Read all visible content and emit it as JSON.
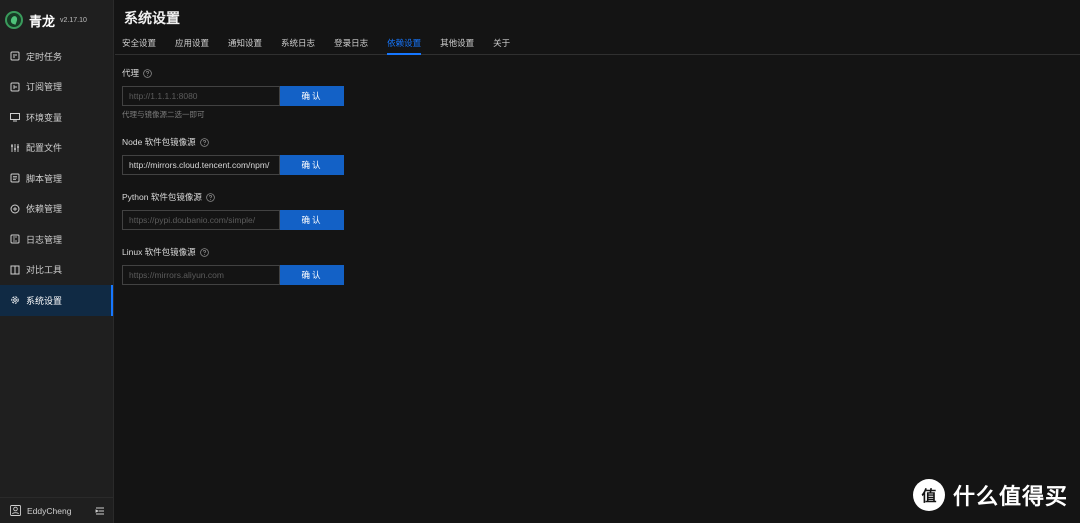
{
  "app": {
    "name": "青龙",
    "version": "v2.17.10"
  },
  "sidebar": {
    "items": [
      {
        "label": "定时任务",
        "icon": "clock-icon"
      },
      {
        "label": "订阅管理",
        "icon": "subscription-icon"
      },
      {
        "label": "环境变量",
        "icon": "monitor-icon"
      },
      {
        "label": "配置文件",
        "icon": "sliders-icon"
      },
      {
        "label": "脚本管理",
        "icon": "script-icon"
      },
      {
        "label": "依赖管理",
        "icon": "dependency-icon"
      },
      {
        "label": "日志管理",
        "icon": "log-icon"
      },
      {
        "label": "对比工具",
        "icon": "diff-icon"
      },
      {
        "label": "系统设置",
        "icon": "gear-icon",
        "active": true
      }
    ],
    "user": {
      "name": "EddyCheng"
    }
  },
  "main": {
    "title": "系统设置",
    "tabs": [
      {
        "label": "安全设置"
      },
      {
        "label": "应用设置"
      },
      {
        "label": "通知设置"
      },
      {
        "label": "系统日志"
      },
      {
        "label": "登录日志"
      },
      {
        "label": "依赖设置",
        "active": true
      },
      {
        "label": "其他设置"
      },
      {
        "label": "关于"
      }
    ],
    "sections": {
      "proxy": {
        "label": "代理",
        "placeholder": "http://1.1.1.1:8080",
        "value": "",
        "button": "确认",
        "hint": "代理与镜像源二选一即可"
      },
      "node": {
        "label": "Node 软件包镜像源",
        "placeholder": "",
        "value": "http://mirrors.cloud.tencent.com/npm/",
        "button": "确认"
      },
      "python": {
        "label": "Python 软件包镜像源",
        "placeholder": "https://pypi.doubanio.com/simple/",
        "value": "",
        "button": "确认"
      },
      "linux": {
        "label": "Linux 软件包镜像源",
        "placeholder": "https://mirrors.aliyun.com",
        "value": "",
        "button": "确认"
      }
    }
  },
  "watermark": {
    "glyph": "值",
    "text": "什么值得买"
  },
  "colors": {
    "accent": "#1677ff",
    "button": "#1361c6",
    "background": "#141414",
    "sidebar": "#1f1f1f"
  }
}
